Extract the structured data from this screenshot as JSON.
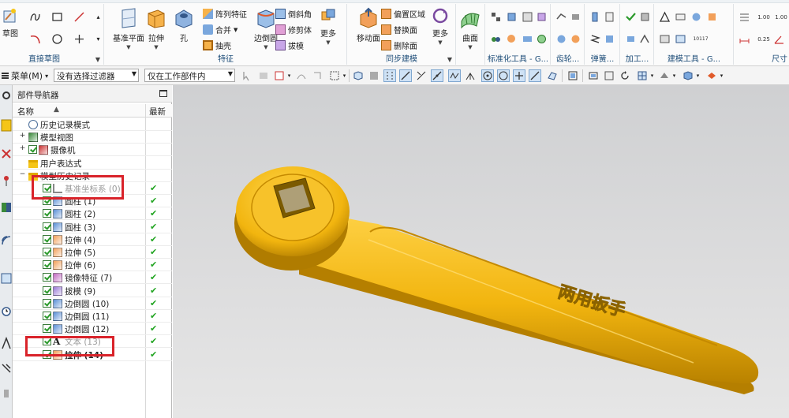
{
  "ribbon": {
    "groups": [
      {
        "label": "直接草图",
        "buttons": [
          {
            "label": "草图",
            "icon": "sketch-icon"
          }
        ]
      },
      {
        "label": "特征",
        "buttons": [
          {
            "label": "基准平面",
            "icon": "datum-plane-icon"
          },
          {
            "label": "拉伸",
            "icon": "extrude-icon"
          },
          {
            "label": "孔",
            "icon": "hole-icon"
          },
          {
            "label": "边倒圆",
            "icon": "edge-blend-icon"
          },
          {
            "label": "更多",
            "icon": "more-icon"
          }
        ],
        "small": [
          {
            "label": "阵列特征",
            "icon": "pattern-feature-icon"
          },
          {
            "label": "合并",
            "icon": "unite-icon"
          },
          {
            "label": "抽壳",
            "icon": "shell-icon"
          },
          {
            "label": "倒斜角",
            "icon": "chamfer-icon"
          },
          {
            "label": "修剪体",
            "icon": "trim-body-icon"
          },
          {
            "label": "拔模",
            "icon": "draft-icon"
          }
        ]
      },
      {
        "label": "同步建模",
        "buttons": [
          {
            "label": "移动面",
            "icon": "move-face-icon"
          },
          {
            "label": "更多",
            "icon": "more-icon"
          }
        ],
        "small": [
          {
            "label": "偏置区域",
            "icon": "offset-region-icon"
          },
          {
            "label": "替换面",
            "icon": "replace-face-icon"
          },
          {
            "label": "删除面",
            "icon": "delete-face-icon"
          }
        ]
      },
      {
        "label": "",
        "buttons": [
          {
            "label": "曲面",
            "icon": "surface-icon"
          }
        ]
      },
      {
        "label": "标准化工具 - G...",
        "buttons": []
      },
      {
        "label": "齿轮...",
        "buttons": []
      },
      {
        "label": "弹簧...",
        "buttons": []
      },
      {
        "label": "加工...",
        "buttons": []
      },
      {
        "label": "建模工具 - G...",
        "buttons": []
      },
      {
        "label": "尺寸",
        "buttons": []
      }
    ],
    "numbers": [
      "1.00",
      "0.25",
      "10117",
      "1.00"
    ]
  },
  "cmdbar": {
    "menu_label": "菜单(M)",
    "filter_value": "没有选择过滤器",
    "scope_value": "仅在工作部件内"
  },
  "navigator": {
    "title": "部件导航器",
    "col_name": "名称",
    "col_latest": "最新",
    "rows": [
      {
        "label": "历史记录模式",
        "level": 0,
        "icon": "history-mode-icon",
        "check": false,
        "latest": false,
        "style": "normal"
      },
      {
        "label": "模型视图",
        "level": 0,
        "icon": "model-view-icon",
        "check": false,
        "latest": false,
        "style": "normal"
      },
      {
        "label": "摄像机",
        "level": 0,
        "icon": "camera-icon",
        "check": true,
        "latest": false,
        "style": "normal"
      },
      {
        "label": "用户表达式",
        "level": 0,
        "icon": "folder-icon",
        "check": false,
        "latest": false,
        "style": "normal"
      },
      {
        "label": "模型历史记录",
        "level": 0,
        "icon": "folder-icon",
        "check": false,
        "latest": false,
        "style": "normal"
      },
      {
        "label": "基准坐标系 (0)",
        "level": 1,
        "icon": "datum-csys-icon",
        "check": true,
        "latest": true,
        "style": "dim"
      },
      {
        "label": "圆柱 (1)",
        "level": 1,
        "icon": "cylinder-icon",
        "check": true,
        "latest": true,
        "style": "normal"
      },
      {
        "label": "圆柱 (2)",
        "level": 1,
        "icon": "cylinder-icon",
        "check": true,
        "latest": true,
        "style": "normal"
      },
      {
        "label": "圆柱 (3)",
        "level": 1,
        "icon": "cylinder-icon",
        "check": true,
        "latest": true,
        "style": "normal"
      },
      {
        "label": "拉伸 (4)",
        "level": 1,
        "icon": "extrude-icon",
        "check": true,
        "latest": true,
        "style": "normal"
      },
      {
        "label": "拉伸 (5)",
        "level": 1,
        "icon": "extrude-icon",
        "check": true,
        "latest": true,
        "style": "normal"
      },
      {
        "label": "拉伸 (6)",
        "level": 1,
        "icon": "extrude-icon",
        "check": true,
        "latest": true,
        "style": "normal"
      },
      {
        "label": "镜像特征 (7)",
        "level": 1,
        "icon": "mirror-feature-icon",
        "check": true,
        "latest": true,
        "style": "normal"
      },
      {
        "label": "拔模 (9)",
        "level": 1,
        "icon": "draft-icon",
        "check": true,
        "latest": true,
        "style": "normal"
      },
      {
        "label": "边倒圆 (10)",
        "level": 1,
        "icon": "edge-blend-icon",
        "check": true,
        "latest": true,
        "style": "normal"
      },
      {
        "label": "边倒圆 (11)",
        "level": 1,
        "icon": "edge-blend-icon",
        "check": true,
        "latest": true,
        "style": "normal"
      },
      {
        "label": "边倒圆 (12)",
        "level": 1,
        "icon": "edge-blend-icon",
        "check": true,
        "latest": true,
        "style": "normal"
      },
      {
        "label": "文本 (13)",
        "level": 1,
        "icon": "text-icon",
        "check": true,
        "latest": true,
        "style": "dim"
      },
      {
        "label": "拉伸 (14)",
        "level": 1,
        "icon": "extrude-icon",
        "check": true,
        "latest": true,
        "style": "bold"
      }
    ]
  },
  "viewport": {
    "model_text": "两用扳手",
    "model_color": "#f2b50f",
    "highlight_color": "#d9232a"
  }
}
